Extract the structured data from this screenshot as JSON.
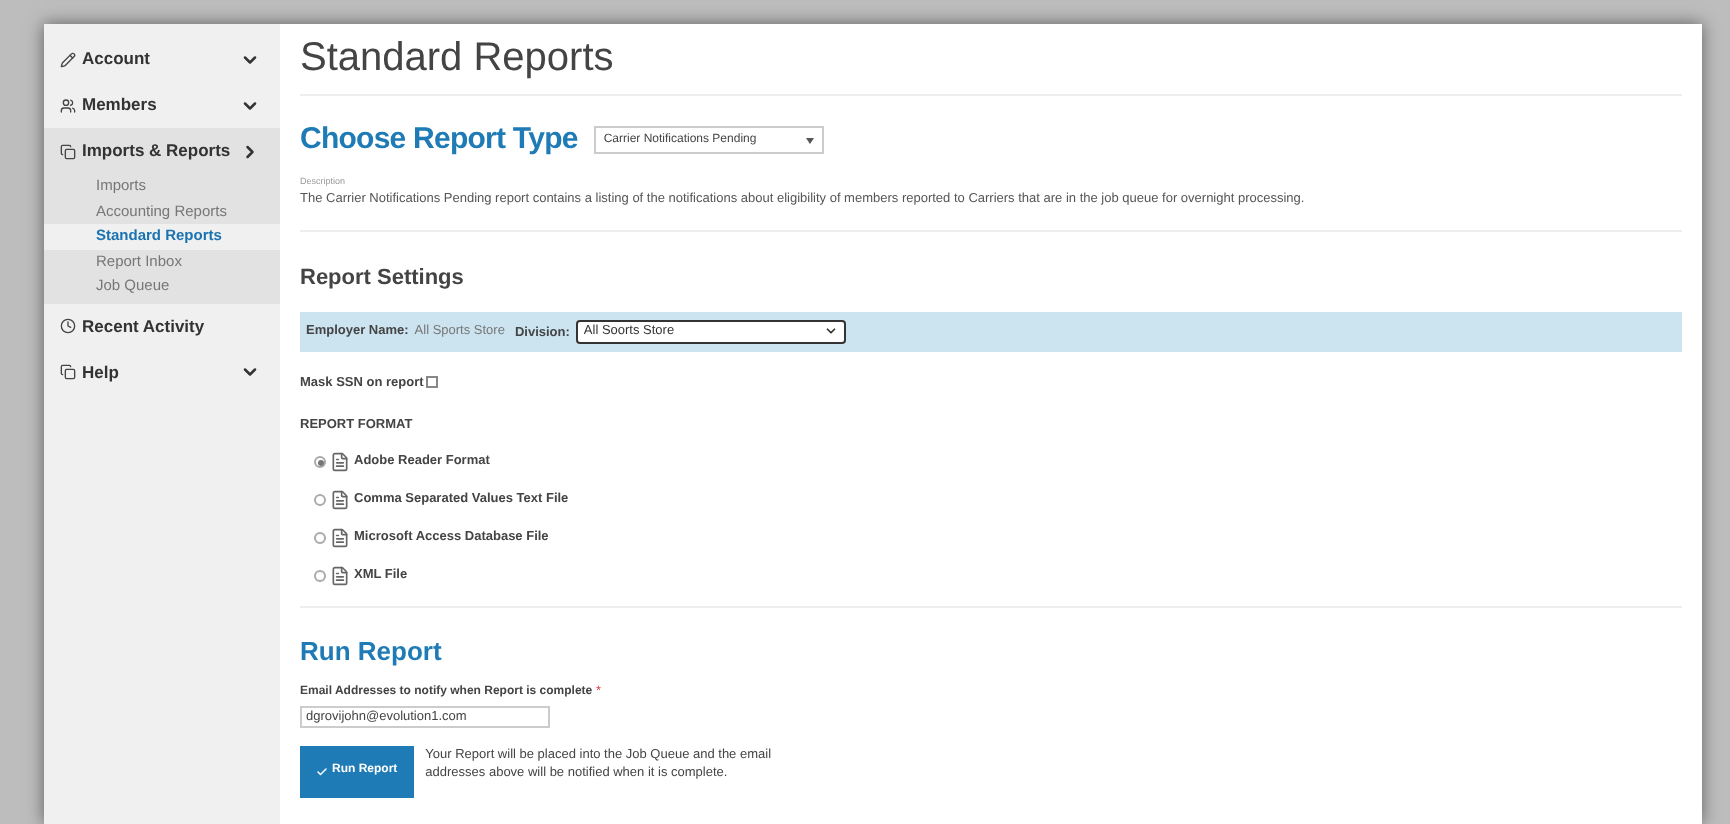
{
  "sidebar": {
    "items": [
      {
        "label": "Account",
        "kind": "menu",
        "expanded": false
      },
      {
        "label": "Members",
        "kind": "menu",
        "expanded": false
      },
      {
        "label": "Imports & Reports",
        "kind": "menu",
        "expanded": true,
        "children": [
          {
            "label": "Imports",
            "selected": false
          },
          {
            "label": "Accounting Reports",
            "selected": false
          },
          {
            "label": "Standard Reports",
            "selected": true
          },
          {
            "label": "Report Inbox",
            "selected": false
          },
          {
            "label": "Job Queue",
            "selected": false
          }
        ]
      },
      {
        "label": "Recent Activity",
        "kind": "link",
        "expanded": false
      },
      {
        "label": "Help",
        "kind": "menu",
        "expanded": false
      }
    ]
  },
  "page_title": "Standard Reports",
  "report_type": {
    "heading": "Choose Report Type",
    "value": "Carrier Notifications Pending",
    "description_label": "Description",
    "description": "The Carrier Notifications Pending report contains a listing of the notifications about eligibility of members reported to Carriers that are in the job queue for overnight processing."
  },
  "settings": {
    "heading": "Report Settings",
    "employer_label": "Employer Name:",
    "employer_value": "All Sports Store",
    "division_label": "Division:",
    "division_value": "All Soorts Store",
    "mask_label": "Mask SSN on report",
    "mask_checked": false,
    "format_heading": "REPORT FORMAT",
    "formats": [
      {
        "label": "Adobe Reader Format",
        "selected": true
      },
      {
        "label": "Comma Separated Values Text File",
        "selected": false
      },
      {
        "label": "Microsoft Access Database File",
        "selected": false
      },
      {
        "label": "XML File",
        "selected": false
      }
    ]
  },
  "run": {
    "heading": "Run Report",
    "email_label": "Email Addresses to notify when Report is complete",
    "required_mark": "*",
    "email_value": "dgrovijohn@evolution1.com",
    "button": "Run Report",
    "note": "Your Report will be placed into the Job Queue and the email addresses above will be notified when it is complete."
  }
}
